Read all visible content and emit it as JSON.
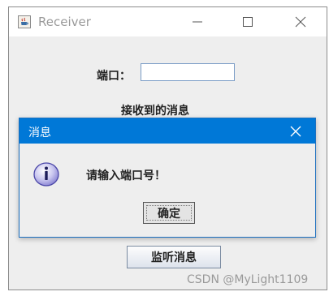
{
  "window": {
    "title": "Receiver",
    "port_label": "端口：",
    "port_value": "",
    "received_label": "接收到的消息",
    "listen_button": "监听消息"
  },
  "dialog": {
    "title": "消息",
    "message": "请输入端口号！",
    "ok_button": "确定",
    "icon": "info-icon"
  },
  "watermark": "CSDN @MyLight1109",
  "colors": {
    "dialog_titlebar": "#0078d7",
    "window_background": "#eeeeee"
  }
}
